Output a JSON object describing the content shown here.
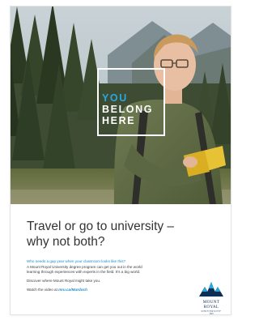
{
  "badge": {
    "line1": "YOU",
    "line2": "BELONG",
    "line3": "HERE"
  },
  "headline": {
    "line1": "Travel or go to university –",
    "line2": "why not both?"
  },
  "body": {
    "p1_line1": "Who needs a gap year when your classroom looks like this?",
    "p1_line2": "A Mount Royal University degree program can get you out in the world",
    "p1_line3": "learning through experiences with experts in the field. It’s a big world.",
    "p2": "Discover where Mount Royal might take you.",
    "p3_prefix": "Watch the video at ",
    "p3_link": "mru.ca/Murdoch"
  },
  "logo": {
    "name": "MOUNT ROYAL",
    "sub": "UNIVERSITY",
    "year": "1910"
  },
  "colors": {
    "accent": "#27a8e0",
    "brand_navy": "#0c2f55"
  }
}
